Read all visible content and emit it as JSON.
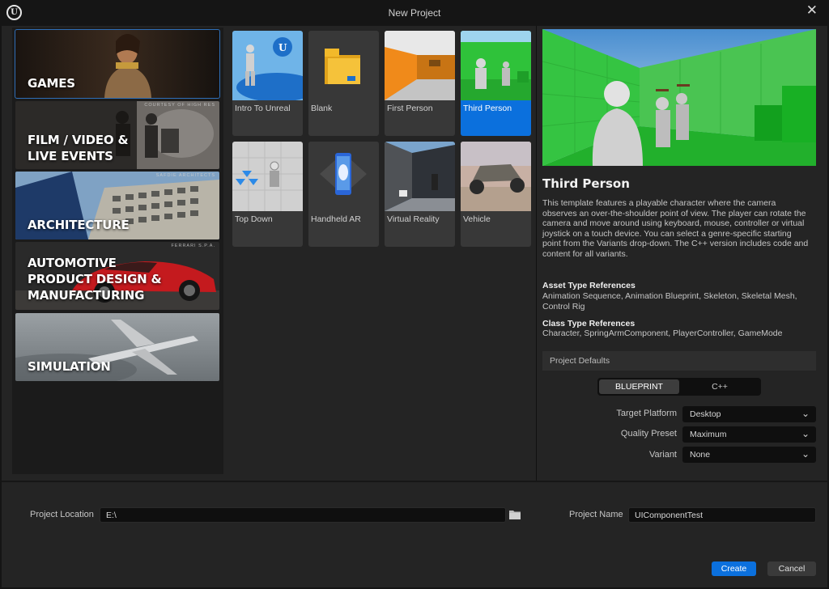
{
  "window": {
    "title": "New Project",
    "logo_glyph": "U"
  },
  "categories": [
    {
      "label": "GAMES",
      "credit": "",
      "selected": true
    },
    {
      "label": "FILM / VIDEO & LIVE EVENTS",
      "credit": "COURTESY OF HIGH RES",
      "selected": false
    },
    {
      "label": "ARCHITECTURE",
      "credit": "SAFDIE ARCHITECTS",
      "selected": false
    },
    {
      "label": "AUTOMOTIVE PRODUCT DESIGN & MANUFACTURING",
      "credit": "FERRARI S.P.A.",
      "selected": false
    },
    {
      "label": "SIMULATION",
      "credit": "",
      "selected": false
    }
  ],
  "category_lines": {
    "games": [
      "GAMES"
    ],
    "film": [
      "FILM / VIDEO &",
      "LIVE EVENTS"
    ],
    "architecture": [
      "ARCHITECTURE"
    ],
    "automotive": [
      "AUTOMOTIVE",
      "PRODUCT DESIGN &",
      "MANUFACTURING"
    ],
    "simulation": [
      "SIMULATION"
    ]
  },
  "templates": [
    {
      "label": "Intro To Unreal",
      "selected": false
    },
    {
      "label": "Blank",
      "selected": false
    },
    {
      "label": "First Person",
      "selected": false
    },
    {
      "label": "Third Person",
      "selected": true
    },
    {
      "label": "Top Down",
      "selected": false
    },
    {
      "label": "Handheld AR",
      "selected": false
    },
    {
      "label": "Virtual Reality",
      "selected": false
    },
    {
      "label": "Vehicle",
      "selected": false
    }
  ],
  "details": {
    "title": "Third Person",
    "description": "This template features a playable character where the camera observes an over-the-shoulder point of view. The player can rotate the camera and move around using keyboard, mouse, controller or virtual joystick on a touch device. You can select a genre-specific starting point from the Variants drop-down. The C++ version includes code and content for all variants.",
    "asset_refs_heading": "Asset Type References",
    "asset_refs": "Animation Sequence, Animation Blueprint, Skeleton, Skeletal Mesh, Control Rig",
    "class_refs_heading": "Class Type References",
    "class_refs": "Character, SpringArmComponent, PlayerController, GameMode"
  },
  "defaults": {
    "section_label": "Project Defaults",
    "language_options": [
      "BLUEPRINT",
      "C++"
    ],
    "language_selected": "BLUEPRINT",
    "target_platform": {
      "label": "Target Platform",
      "value": "Desktop"
    },
    "quality_preset": {
      "label": "Quality Preset",
      "value": "Maximum"
    },
    "variant": {
      "label": "Variant",
      "value": "None"
    }
  },
  "footer": {
    "location_label": "Project Location",
    "location_value": "E:\\",
    "name_label": "Project Name",
    "name_value": "UIComponentTest",
    "create_label": "Create",
    "cancel_label": "Cancel"
  },
  "colors": {
    "accent": "#0b70dd",
    "background": "#242424",
    "panel": "#1b1b1b",
    "tile": "#383838"
  }
}
